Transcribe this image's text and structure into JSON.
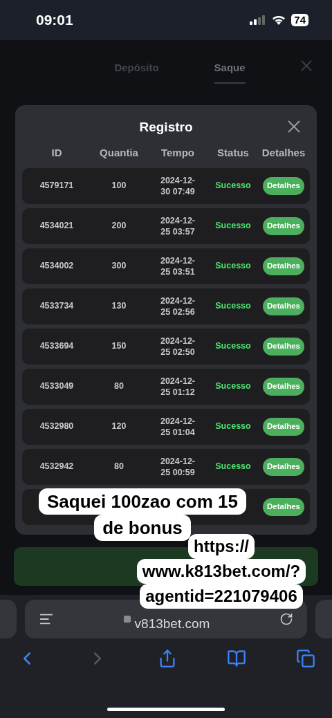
{
  "status_bar": {
    "time": "09:01",
    "battery": "74"
  },
  "tabs": [
    {
      "label": "Depósito",
      "selected": false
    },
    {
      "label": "Saque",
      "selected": true
    }
  ],
  "modal": {
    "title": "Registro",
    "columns": [
      "ID",
      "Quantia",
      "Tempo",
      "Status",
      "Detalhes"
    ],
    "rows": [
      {
        "id": "4579171",
        "amount": "100",
        "time": "2024-12-30 07:49",
        "status": "Sucesso",
        "action": "Detalhes"
      },
      {
        "id": "4534021",
        "amount": "200",
        "time": "2024-12-25 03:57",
        "status": "Sucesso",
        "action": "Detalhes"
      },
      {
        "id": "4534002",
        "amount": "300",
        "time": "2024-12-25 03:51",
        "status": "Sucesso",
        "action": "Detalhes"
      },
      {
        "id": "4533734",
        "amount": "130",
        "time": "2024-12-25 02:56",
        "status": "Sucesso",
        "action": "Detalhes"
      },
      {
        "id": "4533694",
        "amount": "150",
        "time": "2024-12-25 02:50",
        "status": "Sucesso",
        "action": "Detalhes"
      },
      {
        "id": "4533049",
        "amount": "80",
        "time": "2024-12-25 01:12",
        "status": "Sucesso",
        "action": "Detalhes"
      },
      {
        "id": "4532980",
        "amount": "120",
        "time": "2024-12-25 01:04",
        "status": "Sucesso",
        "action": "Detalhes"
      },
      {
        "id": "4532942",
        "amount": "80",
        "time": "2024-12-25 00:59",
        "status": "Sucesso",
        "action": "Detalhes"
      },
      {
        "action": "Detalhes"
      }
    ]
  },
  "browser": {
    "url": "v813bet.com",
    "back_enabled": true,
    "forward_enabled": false
  },
  "captions": [
    {
      "lines": [
        "Saquei 100zao com 15",
        "de bonus"
      ]
    },
    {
      "lines": [
        "https://",
        "www.k813bet.com/?",
        "agentid=221079406"
      ]
    }
  ]
}
